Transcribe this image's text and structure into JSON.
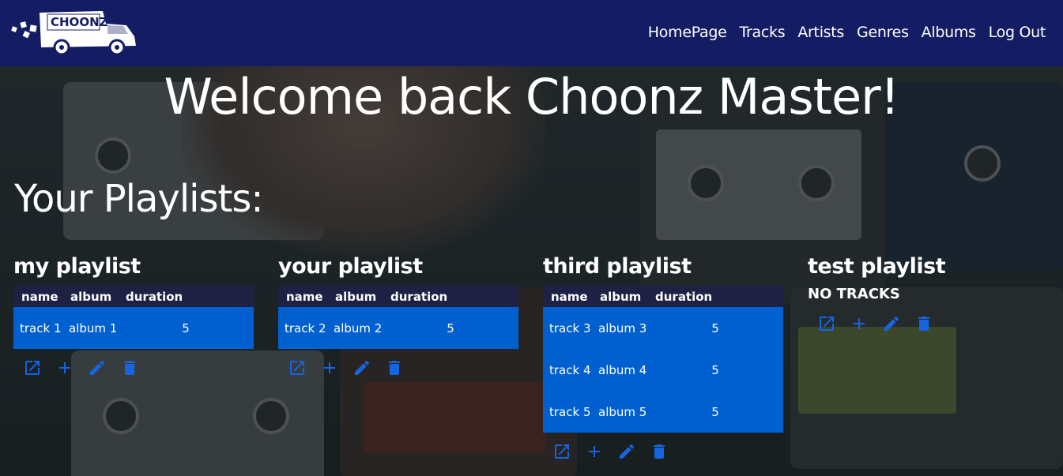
{
  "navbar": {
    "logo_text": "CHOONZ",
    "links": [
      "HomePage",
      "Tracks",
      "Artists",
      "Genres",
      "Albums",
      "Log Out"
    ]
  },
  "main": {
    "welcome": "Welcome back Choonz Master!",
    "section_title": "Your Playlists:",
    "table_headers": {
      "name": "name",
      "album": "album",
      "duration": "duration"
    },
    "playlists": [
      {
        "title": "my playlist",
        "tracks": [
          {
            "name": "track 1",
            "album": "album 1",
            "duration": "5"
          }
        ]
      },
      {
        "title": "your playlist",
        "tracks": [
          {
            "name": "track 2",
            "album": "album 2",
            "duration": "5"
          }
        ]
      },
      {
        "title": "third playlist",
        "tracks": [
          {
            "name": "track 3",
            "album": "album 3",
            "duration": "5"
          },
          {
            "name": "track 4",
            "album": "album 4",
            "duration": "5"
          },
          {
            "name": "track 5",
            "album": "album 5",
            "duration": "5"
          }
        ]
      },
      {
        "title": "test playlist",
        "no_tracks_text": "NO TRACKS",
        "tracks": []
      }
    ],
    "actions": [
      "open-icon",
      "add-icon",
      "edit-icon",
      "delete-icon"
    ],
    "colors": {
      "navbar": "#141d63",
      "row": "#0060d0",
      "header": "#1f2144",
      "icon": "#1565e0"
    }
  }
}
